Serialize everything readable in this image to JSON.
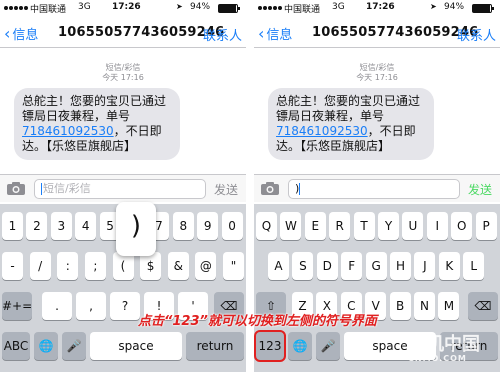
{
  "status_bar": {
    "carrier": "中国联通",
    "network": "3G",
    "time": "17:26",
    "battery_percent": "94%",
    "battery_level": 0.94
  },
  "nav": {
    "back_label": "信息",
    "phone_number": "106550577436059246",
    "contacts_label": "联系人"
  },
  "message": {
    "type_label": "短信/彩信",
    "time_label": "今天 17:16",
    "text_part1": "总舵主！您要的宝贝已通过镖局日夜兼程，单号",
    "tracking_number": "718461092530",
    "text_part2": "，不日即达。【乐悠臣旗舰店】"
  },
  "left_composer": {
    "placeholder": "短信/彩信",
    "send_label": "发送"
  },
  "right_composer": {
    "value": ")",
    "send_label": "发送"
  },
  "left_keyboard": {
    "row1": [
      "1",
      "2",
      "3",
      "4",
      "5",
      ")",
      "7",
      "8",
      "9",
      "0"
    ],
    "row2": [
      "-",
      "/",
      ":",
      ";",
      "(",
      "$",
      "&",
      "@",
      "\""
    ],
    "row3": [
      "#+=",
      ".",
      ",",
      "?",
      "!",
      "'"
    ],
    "popup_key": ")",
    "mode_key": "ABC",
    "space_label": "space",
    "return_label": "return"
  },
  "right_keyboard": {
    "row1": [
      "Q",
      "W",
      "E",
      "R",
      "T",
      "Y",
      "U",
      "I",
      "O",
      "P"
    ],
    "row2": [
      "A",
      "S",
      "D",
      "F",
      "G",
      "H",
      "J",
      "K",
      "L"
    ],
    "row3": [
      "Z",
      "X",
      "C",
      "V",
      "B",
      "N",
      "M"
    ],
    "mode_key": "123",
    "space_label": "space",
    "return_label": "return"
  },
  "annotation": {
    "caption": "点击“123”就可以切换到左侧的符号界面",
    "watermark": "手机中国",
    "watermark_sub": "CNMO.COM"
  },
  "icons": {
    "back": "chevron-left-icon",
    "camera": "camera-icon",
    "globe": "globe-icon",
    "mic": "microphone-icon",
    "delete": "backspace-icon",
    "shift": "shift-icon",
    "location": "location-arrow-icon"
  },
  "colors": {
    "accent": "#1a7ef7",
    "bubble": "#e5e5ea",
    "keyboard_bg": "#d1d4d9",
    "dark_key": "#adb3bc",
    "send_active": "#4cd964",
    "annotation": "#e02020"
  }
}
